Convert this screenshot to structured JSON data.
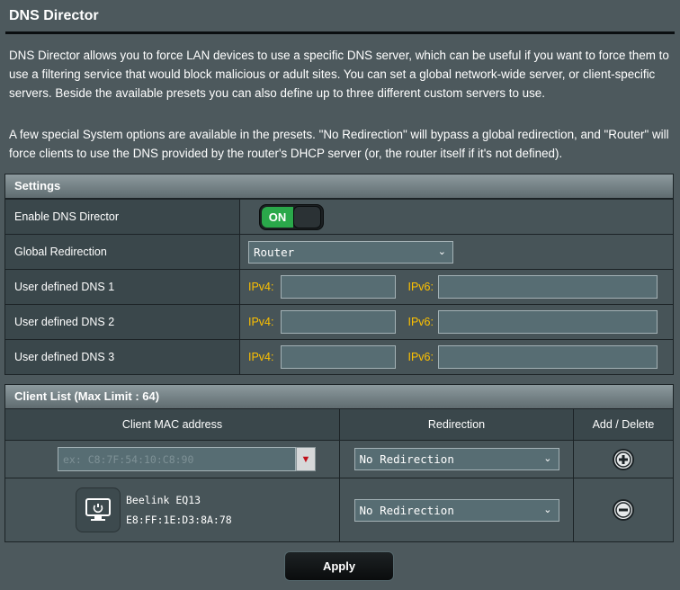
{
  "title": "DNS Director",
  "description1": "DNS Director allows you to force LAN devices to use a specific DNS server, which can be useful if you want to force them to use a filtering service that would block malicious or adult sites. You can set a global network-wide server, or client-specific servers. Beside the available presets you can also define up to three different custom servers to use.",
  "description2": "A few special System options are available in the presets. \"No Redirection\" will bypass a global redirection, and \"Router\" will force clients to use the DNS provided by the router's DHCP server (or, the router itself if it's not defined).",
  "settings": {
    "header": "Settings",
    "enable_label": "Enable DNS Director",
    "toggle_state": "ON",
    "global_label": "Global Redirection",
    "global_value": "Router",
    "dns_rows": [
      {
        "label": "User defined DNS 1",
        "ipv4_label": "IPv4:",
        "ipv6_label": "IPv6:",
        "ipv4": "",
        "ipv6": ""
      },
      {
        "label": "User defined DNS 2",
        "ipv4_label": "IPv4:",
        "ipv6_label": "IPv6:",
        "ipv4": "",
        "ipv6": ""
      },
      {
        "label": "User defined DNS 3",
        "ipv4_label": "IPv4:",
        "ipv6_label": "IPv6:",
        "ipv4": "",
        "ipv6": ""
      }
    ]
  },
  "client_list": {
    "header": "Client List (Max Limit : 64)",
    "columns": [
      "Client MAC address",
      "Redirection",
      "Add / Delete"
    ],
    "new_entry": {
      "mac_placeholder": "ex: C8:7F:54:10:C8:90",
      "redirection": "No Redirection"
    },
    "clients": [
      {
        "name": "Beelink EQ13",
        "mac": "E8:FF:1E:D3:8A:78",
        "redirection": "No Redirection"
      }
    ]
  },
  "apply_label": "Apply",
  "colors": {
    "background": "#4d595d",
    "accent_label": "#fcc000",
    "toggle_on": "#2aa84a"
  }
}
